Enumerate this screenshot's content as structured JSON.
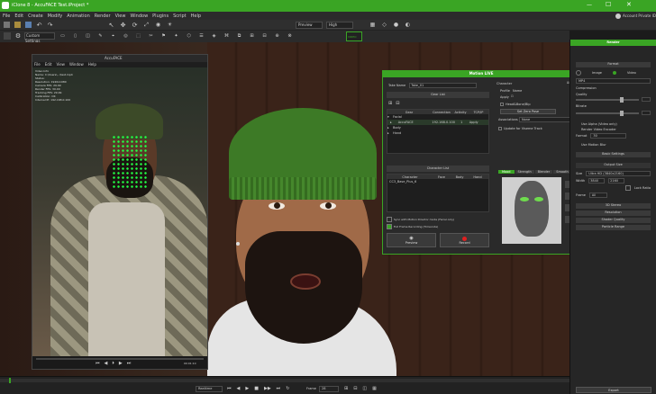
{
  "window": {
    "title": "iClone 8 - AccuFACE Test.iProject *",
    "controls": [
      "—",
      "☐",
      "✕"
    ],
    "accent": "#3aa524"
  },
  "menu": [
    "File",
    "Edit",
    "Create",
    "Modify",
    "Animation",
    "Render",
    "View",
    "Window",
    "Plugins",
    "Script",
    "Help"
  ],
  "notification": "Account Private ID",
  "toolbar": {
    "custom_settings": "Custom Settings",
    "preview": "Preview",
    "high": "High",
    "hd_label": "Hd label",
    "video_label": "VIDEO"
  },
  "accuface": {
    "title": "AccuFACE",
    "menu": [
      "File",
      "Edit",
      "View",
      "Window",
      "Help"
    ],
    "stats": [
      "Video Info",
      "Name: C:\\Users\\...\\test.mp4",
      "Status:",
      "Resolution: 1920x1080",
      "Camera FPS: 29.99",
      "Render FPS: 30.00",
      "Tracking FPS: 29.99",
      "Calibration: OK",
      "Internal IP: 192.168.0.100"
    ],
    "time": "00:01:10"
  },
  "motion_live": {
    "title": "Motion LIVE",
    "scene_name_label": "Take Name",
    "scene_name_value": "Take_01",
    "gear_list_label": "Gear List",
    "table_headers": [
      "Gear",
      "Connection",
      "Activity",
      "TCP/IP"
    ],
    "rows": [
      {
        "expand": "▾",
        "name": "Facial",
        "conn": "",
        "act": "",
        "ip": ""
      },
      {
        "expand": "▸",
        "name": "AccuFACE",
        "conn": "192.168.0.100",
        "act": "1",
        "ip": "Apply"
      },
      {
        "expand": "▸",
        "name": "Body",
        "conn": "",
        "act": "",
        "ip": ""
      },
      {
        "expand": "▸",
        "name": "Hand",
        "conn": "",
        "act": "",
        "ip": ""
      }
    ],
    "character_list_label": "Character List",
    "char_headers": [
      "Character",
      "Face",
      "Body",
      "Hand"
    ],
    "char_rows": [
      {
        "name": "CC3_Base_Plus_6",
        "face": "",
        "body": "",
        "hand": ""
      }
    ],
    "checkbox1": "Sync with Motion Director mode (Facial only)",
    "checkbox2": "Full Frame Recording (Timecode)",
    "preview_label": "Preview",
    "record_label": "Record",
    "character_label": "Character",
    "profile_label": "Profile",
    "name_label": "Name",
    "apply_label": "Apply",
    "head_label": "Head&Bone/Bip",
    "set_zero": "Set Zero Pose",
    "associations_label": "Associations",
    "associations_value": "None",
    "strength_check": "Update for Viseme Track",
    "tabs": [
      "Mood",
      "Strength",
      "Blender",
      "Smooth"
    ]
  },
  "right_panel": {
    "header": "Render",
    "sub_header": "Format",
    "tabs": [
      "Image",
      "Video"
    ],
    "format_label": "MP4",
    "compression": "Compression",
    "rows": [
      "Quality",
      "Bitrate",
      "Use Alpha (Video only)",
      "Render Video Encoder",
      "Format",
      "Use Motion Blur",
      "Basic Settings",
      "Output Size",
      "Size",
      "Width",
      "Height",
      "Lock Ratio",
      "Frame"
    ],
    "format_value": "30",
    "size_value": "Ultra HD (3840x2160)",
    "width_value": "3840",
    "height_value": "2160",
    "frame_value": "All",
    "sections": [
      "3D Stereo",
      "Resolution",
      "Shader Quality",
      "Particle Range"
    ],
    "export_label": "Export"
  },
  "timeline": {
    "realtime_label": "Realtime",
    "frame_label": "Frame",
    "frame_value": "28"
  }
}
